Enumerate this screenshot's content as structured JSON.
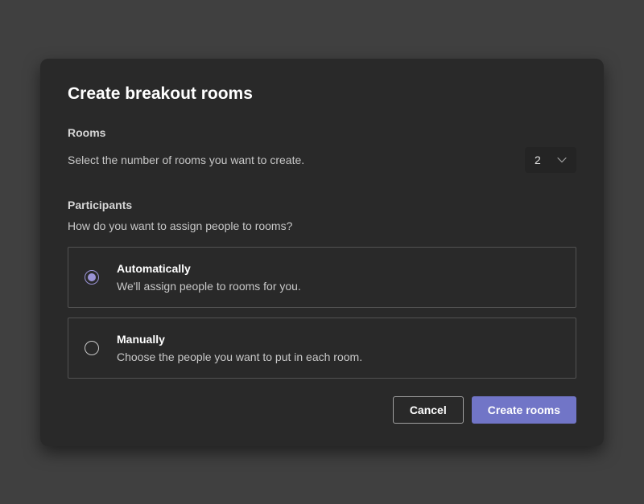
{
  "dialog": {
    "title": "Create breakout rooms"
  },
  "rooms": {
    "label": "Rooms",
    "helper": "Select the number of rooms you want to create.",
    "value": "2"
  },
  "participants": {
    "label": "Participants",
    "question": "How do you want to assign people to rooms?",
    "options": {
      "auto": {
        "title": "Automatically",
        "desc": "We'll assign people to rooms for you.",
        "selected": true
      },
      "manual": {
        "title": "Manually",
        "desc": "Choose the people you want to put in each room.",
        "selected": false
      }
    }
  },
  "buttons": {
    "cancel": "Cancel",
    "create": "Create rooms"
  }
}
